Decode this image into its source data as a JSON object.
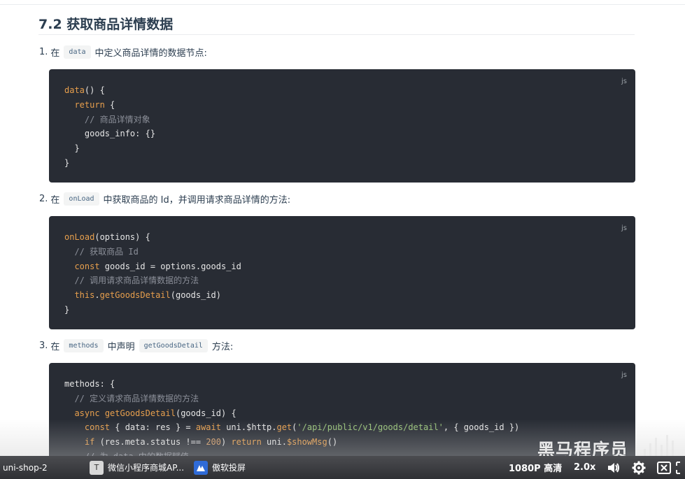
{
  "heading": "7.2 获取商品详情数据",
  "steps": [
    {
      "num": "1.",
      "pre": "在",
      "code1": "data",
      "mid": "中定义商品详情的数据节点:",
      "code2": "",
      "post": ""
    },
    {
      "num": "2.",
      "pre": "在",
      "code1": "onLoad",
      "mid": "中获取商品的 Id，并调用请求商品详情的方法:",
      "code2": "",
      "post": ""
    },
    {
      "num": "3.",
      "pre": "在",
      "code1": "methods",
      "mid": "中声明",
      "code2": "getGoodsDetail",
      "post": "方法:"
    }
  ],
  "code_blocks": [
    {
      "lang": "js",
      "lines": [
        [
          {
            "t": "fn",
            "v": "data"
          },
          {
            "t": "op",
            "v": "() {"
          }
        ],
        [
          {
            "t": "op",
            "v": "  "
          },
          {
            "t": "kw",
            "v": "return"
          },
          {
            "t": "op",
            "v": " {"
          }
        ],
        [
          {
            "t": "cm",
            "v": "    // 商品详情对象"
          }
        ],
        [
          {
            "t": "op",
            "v": "    goods_info: {}"
          }
        ],
        [
          {
            "t": "op",
            "v": "  }"
          }
        ],
        [
          {
            "t": "op",
            "v": "}"
          }
        ]
      ]
    },
    {
      "lang": "js",
      "lines": [
        [
          {
            "t": "fn",
            "v": "onLoad"
          },
          {
            "t": "op",
            "v": "(options) {"
          }
        ],
        [
          {
            "t": "cm",
            "v": "  // 获取商品 Id"
          }
        ],
        [
          {
            "t": "op",
            "v": "  "
          },
          {
            "t": "kw",
            "v": "const"
          },
          {
            "t": "op",
            "v": " goods_id = options.goods_id"
          }
        ],
        [
          {
            "t": "cm",
            "v": "  // 调用请求商品详情数据的方法"
          }
        ],
        [
          {
            "t": "op",
            "v": "  "
          },
          {
            "t": "kw",
            "v": "this"
          },
          {
            "t": "op",
            "v": "."
          },
          {
            "t": "fn",
            "v": "getGoodsDetail"
          },
          {
            "t": "op",
            "v": "(goods_id)"
          }
        ],
        [
          {
            "t": "op",
            "v": "}"
          }
        ]
      ]
    },
    {
      "lang": "js",
      "lines": [
        [
          {
            "t": "op",
            "v": "methods: {"
          }
        ],
        [
          {
            "t": "cm",
            "v": "  // 定义请求商品详情数据的方法"
          }
        ],
        [
          {
            "t": "op",
            "v": "  "
          },
          {
            "t": "kw",
            "v": "async"
          },
          {
            "t": "op",
            "v": " "
          },
          {
            "t": "fn",
            "v": "getGoodsDetail"
          },
          {
            "t": "op",
            "v": "(goods_id) {"
          }
        ],
        [
          {
            "t": "op",
            "v": "    "
          },
          {
            "t": "kw",
            "v": "const"
          },
          {
            "t": "op",
            "v": " { data: res } = "
          },
          {
            "t": "kw",
            "v": "await"
          },
          {
            "t": "op",
            "v": " uni.$http."
          },
          {
            "t": "fn",
            "v": "get"
          },
          {
            "t": "op",
            "v": "("
          },
          {
            "t": "str",
            "v": "'/api/public/v1/goods/detail'"
          },
          {
            "t": "op",
            "v": ", { goods_id })"
          }
        ],
        [
          {
            "t": "op",
            "v": "    "
          },
          {
            "t": "kw",
            "v": "if"
          },
          {
            "t": "op",
            "v": " (res.meta.status !== "
          },
          {
            "t": "num",
            "v": "200"
          },
          {
            "t": "op",
            "v": ") "
          },
          {
            "t": "kw",
            "v": "return"
          },
          {
            "t": "op",
            "v": " uni."
          },
          {
            "t": "fn",
            "v": "$showMsg"
          },
          {
            "t": "op",
            "v": "()"
          }
        ],
        [
          {
            "t": "cm",
            "v": "    // 为 data 中的数据赋值"
          }
        ]
      ]
    }
  ],
  "watermark": "黑马程序员",
  "taskbar": {
    "items": [
      {
        "label": "uni-shop-2",
        "icon": ""
      },
      {
        "label": "微信小程序商城AP...",
        "icon": "text-file-icon"
      },
      {
        "label": "傲软投屏",
        "icon": "apowermirror-icon"
      }
    ],
    "quality": "1080P 高清",
    "speed": "2.0x"
  }
}
